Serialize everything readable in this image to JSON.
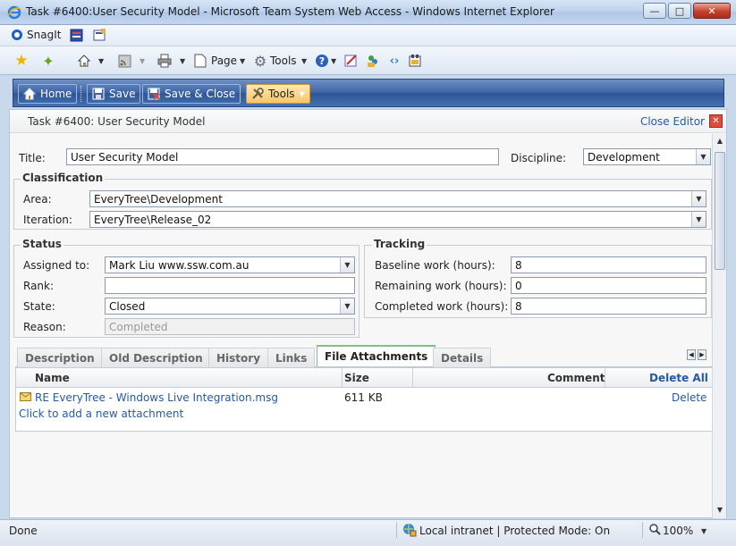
{
  "window": {
    "title": "Task #6400:User Security Model - Microsoft Team System Web Access - Windows Internet Explorer"
  },
  "snagit": {
    "label": "SnagIt"
  },
  "ie_toolbar": {
    "page_label": "Page",
    "tools_label": "Tools"
  },
  "wa_toolbar": {
    "home_label": "Home",
    "save_label": "Save",
    "save_close_label": "Save & Close",
    "tools_label": "Tools"
  },
  "editor": {
    "task_title": "Task #6400: User Security Model",
    "close_editor": "Close Editor"
  },
  "form": {
    "title_label": "Title:",
    "title_value": "User Security Model",
    "discipline_label": "Discipline:",
    "discipline_value": "Development",
    "classification": {
      "heading": "Classification",
      "area_label": "Area:",
      "area_value": "EveryTree\\Development",
      "iteration_label": "Iteration:",
      "iteration_value": "EveryTree\\Release_02"
    },
    "status": {
      "heading": "Status",
      "assigned_label": "Assigned to:",
      "assigned_value": "Mark Liu www.ssw.com.au",
      "rank_label": "Rank:",
      "rank_value": "",
      "state_label": "State:",
      "state_value": "Closed",
      "reason_label": "Reason:",
      "reason_value": "Completed"
    },
    "tracking": {
      "heading": "Tracking",
      "baseline_label": "Baseline work (hours):",
      "baseline_value": "8",
      "remaining_label": "Remaining work (hours):",
      "remaining_value": "0",
      "completed_label": "Completed work (hours):",
      "completed_value": "8"
    }
  },
  "tabs": [
    {
      "label": "Description"
    },
    {
      "label": "Old Description"
    },
    {
      "label": "History"
    },
    {
      "label": "Links"
    },
    {
      "label": "File Attachments"
    },
    {
      "label": "Details"
    }
  ],
  "attachments": {
    "columns": {
      "name": "Name",
      "size": "Size",
      "comment": "Comment",
      "delete_all": "Delete All"
    },
    "rows": [
      {
        "name": "RE EveryTree - Windows Live Integration.msg",
        "size": "611 KB",
        "comment": "",
        "delete": "Delete"
      }
    ],
    "add_link": "Click to add a new attachment"
  },
  "statusbar": {
    "status": "Done",
    "zone": "Local intranet | Protected Mode: On",
    "zoom": "100%"
  }
}
